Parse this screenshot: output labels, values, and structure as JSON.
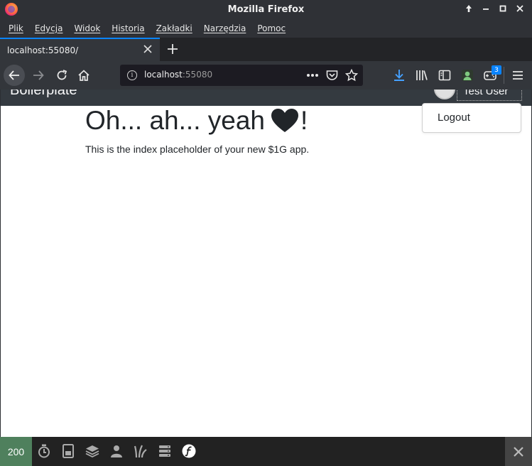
{
  "window": {
    "title": "Mozilla Firefox"
  },
  "menu": [
    "Plik",
    "Edycja",
    "Widok",
    "Historia",
    "Zakładki",
    "Narzędzia",
    "Pomoc"
  ],
  "tab": {
    "label": "localhost:55080/"
  },
  "url": {
    "host": "localhost",
    "port": ":55080"
  },
  "extensions_badge": "3",
  "page": {
    "brand": "Boilerplate",
    "user_name": "Test User",
    "dropdown_logout": "Logout",
    "heading_before": "Oh... ah... yeah",
    "heading_after": "!",
    "lead": "This is the index placeholder of your new $1G app."
  },
  "debug_toolbar": {
    "status_code": "200"
  },
  "colors": {
    "accent": "#0a84ff",
    "status_ok": "#4f805d",
    "navbar_dark": "#343a40"
  },
  "icons": {
    "toolbar": [
      "timer-icon",
      "memory-icon",
      "layers-icon",
      "user-icon",
      "twig-icon",
      "database-icon",
      "symfony-icon"
    ]
  }
}
